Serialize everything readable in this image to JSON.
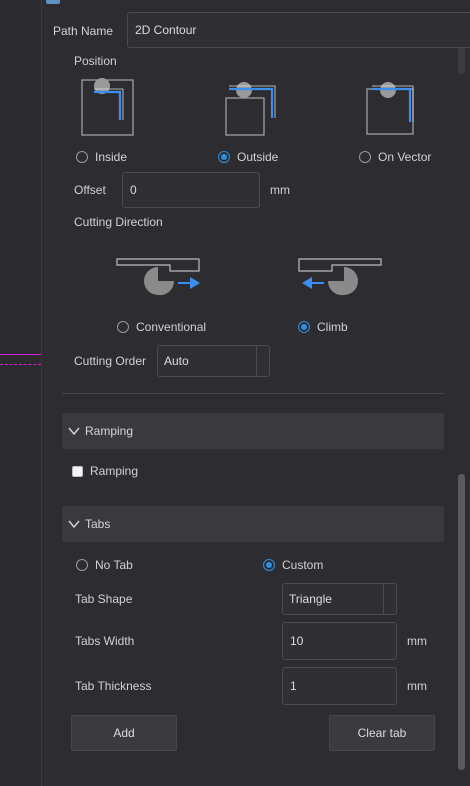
{
  "path_name": {
    "label": "Path Name",
    "value": "2D Contour"
  },
  "position": {
    "title": "Position",
    "options": [
      {
        "label": "Inside",
        "selected": false
      },
      {
        "label": "Outside",
        "selected": true
      },
      {
        "label": "On Vector",
        "selected": false
      }
    ]
  },
  "offset": {
    "label": "Offset",
    "value": "0",
    "unit": "mm"
  },
  "cutting_direction": {
    "title": "Cutting Direction",
    "options": [
      {
        "label": "Conventional",
        "selected": false
      },
      {
        "label": "Climb",
        "selected": true
      }
    ]
  },
  "cutting_order": {
    "label": "Cutting Order",
    "value": "Auto"
  },
  "ramping": {
    "section_title": "Ramping",
    "checkbox_label": "Ramping",
    "checked": false
  },
  "tabs": {
    "section_title": "Tabs",
    "options": [
      {
        "label": "No Tab",
        "selected": false
      },
      {
        "label": "Custom",
        "selected": true
      }
    ],
    "shape": {
      "label": "Tab Shape",
      "value": "Triangle"
    },
    "width": {
      "label": "Tabs Width",
      "value": "10",
      "unit": "mm"
    },
    "thickness": {
      "label": "Tab Thickness",
      "value": "1",
      "unit": "mm"
    },
    "add_label": "Add",
    "clear_label": "Clear tab"
  },
  "colors": {
    "accent": "#2f8fe0",
    "arrow": "#3c8ff0",
    "selection_line": "#d020d0",
    "panel_bg": "#2d2d31",
    "section_bg": "#3a3a3e"
  }
}
